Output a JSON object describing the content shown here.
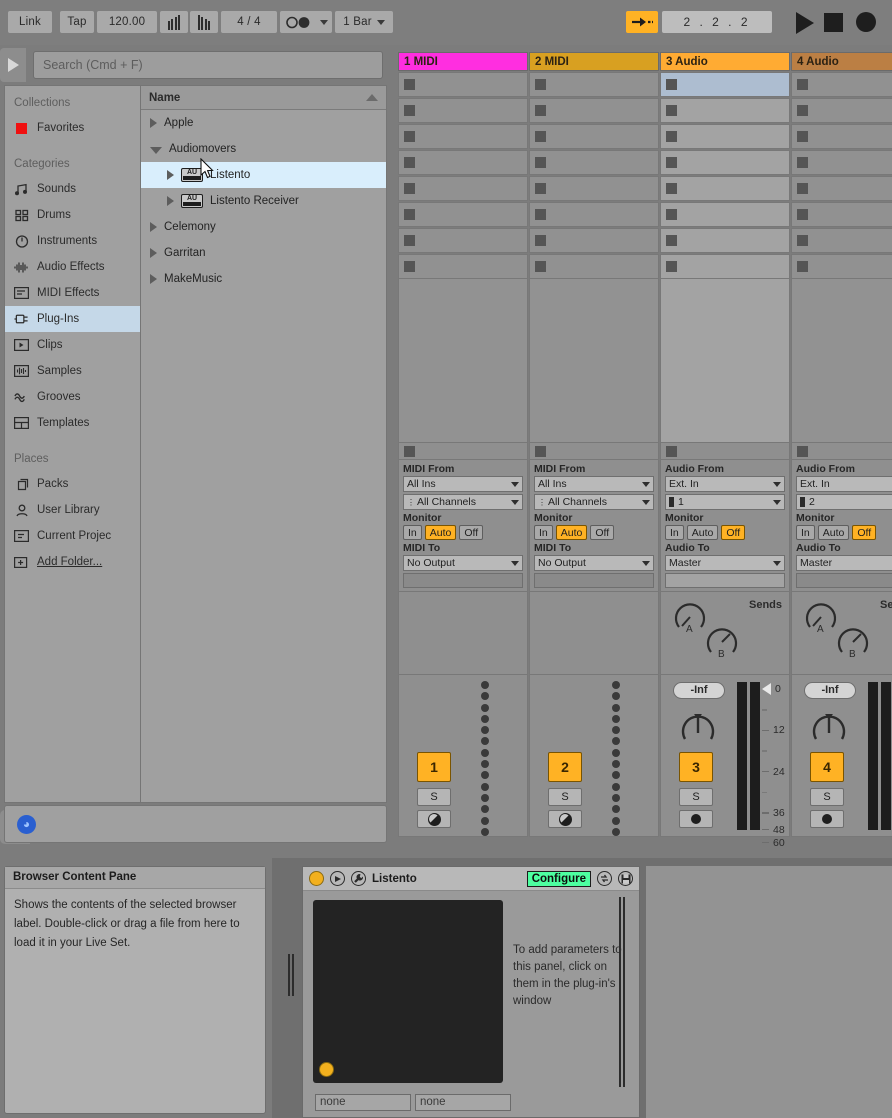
{
  "topbar": {
    "link": "Link",
    "tap": "Tap",
    "tempo": "120.00",
    "signature": "4 / 4",
    "quantization": "1 Bar",
    "position": "2 . 2 . 2",
    "icons": {
      "nudge_down": "nudge-down-icon",
      "nudge_up": "nudge-up-icon",
      "metronome": "metronome-icon",
      "follow": "follow-arrow-icon",
      "play": "play-icon",
      "stop": "stop-icon",
      "record": "record-icon"
    }
  },
  "browser": {
    "search_placeholder": "Search (Cmd + F)",
    "collections_header": "Collections",
    "favorites": "Favorites",
    "categories_header": "Categories",
    "places_header": "Places",
    "categories": [
      {
        "label": "Sounds",
        "icon": "note-icon",
        "selected": false
      },
      {
        "label": "Drums",
        "icon": "drums-icon",
        "selected": false
      },
      {
        "label": "Instruments",
        "icon": "clock-icon",
        "selected": false
      },
      {
        "label": "Audio Effects",
        "icon": "waveform-icon",
        "selected": false
      },
      {
        "label": "MIDI Effects",
        "icon": "midi-icon",
        "selected": false
      },
      {
        "label": "Plug-Ins",
        "icon": "plug-icon",
        "selected": true
      },
      {
        "label": "Clips",
        "icon": "clip-icon",
        "selected": false
      },
      {
        "label": "Samples",
        "icon": "sample-icon",
        "selected": false
      },
      {
        "label": "Grooves",
        "icon": "groove-icon",
        "selected": false
      },
      {
        "label": "Templates",
        "icon": "template-icon",
        "selected": false
      }
    ],
    "places": [
      {
        "label": "Packs",
        "icon": "packs-icon"
      },
      {
        "label": "User Library",
        "icon": "user-icon"
      },
      {
        "label": "Current Projec",
        "icon": "project-icon"
      },
      {
        "label": "Add Folder...",
        "icon": "add-folder-icon"
      }
    ],
    "content_header": "Name",
    "tree": [
      {
        "label": "Apple",
        "expanded": false,
        "indent": 0,
        "au": false,
        "selected": false
      },
      {
        "label": "Audiomovers",
        "expanded": true,
        "indent": 0,
        "au": false,
        "selected": false
      },
      {
        "label": "Listento",
        "expanded": false,
        "indent": 1,
        "au": true,
        "selected": true
      },
      {
        "label": "Listento Receiver",
        "expanded": false,
        "indent": 1,
        "au": true,
        "selected": false
      },
      {
        "label": "Celemony",
        "expanded": false,
        "indent": 0,
        "au": false,
        "selected": false
      },
      {
        "label": "Garritan",
        "expanded": false,
        "indent": 0,
        "au": false,
        "selected": false
      },
      {
        "label": "MakeMusic",
        "expanded": false,
        "indent": 0,
        "au": false,
        "selected": false
      }
    ],
    "footer_icon": "headphones-preview-icon",
    "wave_tab_icon": "waveform-tab-icon"
  },
  "session": {
    "clip_slot_count": 8,
    "tracks": [
      {
        "name": "1 MIDI",
        "color": "#ff2ee0",
        "type": "midi",
        "from_label": "MIDI From",
        "from_value": "All Ins",
        "channel_value": "All Channels",
        "monitor_label": "Monitor",
        "monitor": [
          "In",
          "Auto",
          "Off"
        ],
        "monitor_active": "Auto",
        "to_label": "MIDI To",
        "to_value": "No Output",
        "number": "1",
        "solo": "S",
        "arm_icon": "arm-phase-icon",
        "has_sends": false,
        "has_volume": false,
        "selected_slot": -1
      },
      {
        "name": "2 MIDI",
        "color": "#d8a021",
        "type": "midi",
        "from_label": "MIDI From",
        "from_value": "All Ins",
        "channel_value": "All Channels",
        "monitor_label": "Monitor",
        "monitor": [
          "In",
          "Auto",
          "Off"
        ],
        "monitor_active": "Auto",
        "to_label": "MIDI To",
        "to_value": "No Output",
        "number": "2",
        "solo": "S",
        "arm_icon": "arm-phase-icon",
        "has_sends": false,
        "has_volume": false,
        "selected_slot": -1
      },
      {
        "name": "3 Audio",
        "color": "#ffab33",
        "type": "audio",
        "from_label": "Audio From",
        "from_value": "Ext. In",
        "channel_value": "1",
        "monitor_label": "Monitor",
        "monitor": [
          "In",
          "Auto",
          "Off"
        ],
        "monitor_active": "Off",
        "to_label": "Audio To",
        "to_value": "Master",
        "number": "3",
        "solo": "S",
        "arm_icon": "arm-record-icon",
        "has_sends": true,
        "sends_label": "Sends",
        "send_a": "A",
        "send_b": "B",
        "has_volume": true,
        "volume": "-Inf",
        "selected_slot": 0
      },
      {
        "name": "4 Audio",
        "color": "#bb7f44",
        "type": "audio",
        "from_label": "Audio From",
        "from_value": "Ext. In",
        "channel_value": "2",
        "monitor_label": "Monitor",
        "monitor": [
          "In",
          "Auto",
          "Off"
        ],
        "monitor_active": "Off",
        "to_label": "Audio To",
        "to_value": "Master",
        "number": "4",
        "solo": "S",
        "arm_icon": "arm-record-icon",
        "has_sends": true,
        "sends_label": "Sends",
        "send_a": "A",
        "send_b": "B",
        "has_volume": true,
        "volume": "-Inf",
        "selected_slot": -1
      }
    ],
    "db_scale": [
      "0",
      "12",
      "24",
      "36",
      "48",
      "60"
    ]
  },
  "info_pane": {
    "title": "Browser Content Pane",
    "text": "Shows the contents of the selected browser label. Double-click or drag a file from here to load it in your Live Set."
  },
  "device": {
    "title": "Listento",
    "configure_label": "Configure",
    "hint": "To add parameters to this panel, click on them in the plug-in's window",
    "param_slots": [
      "none",
      "none"
    ],
    "icons": {
      "power_led": "device-power-led-icon",
      "preview": "device-play-icon",
      "wrench": "device-wrench-icon",
      "hot_swap": "hot-swap-icon",
      "save": "save-preset-icon"
    }
  }
}
